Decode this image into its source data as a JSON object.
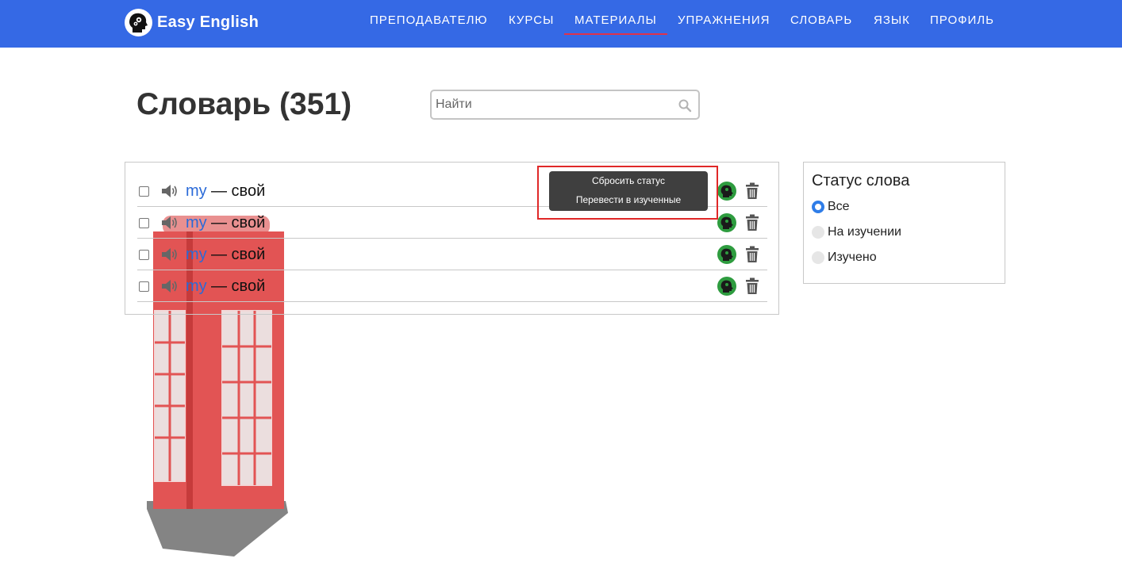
{
  "header": {
    "brand": "Easy English",
    "nav": [
      {
        "label": "ПРЕПОДАВАТЕЛЮ",
        "active": false
      },
      {
        "label": "КУРСЫ",
        "active": false
      },
      {
        "label": "МАТЕРИАЛЫ",
        "active": true
      },
      {
        "label": "УПРАЖНЕНИЯ",
        "active": false
      },
      {
        "label": "СЛОВАРЬ",
        "active": false
      },
      {
        "label": "ЯЗЫК",
        "active": false
      },
      {
        "label": "ПРОФИЛЬ",
        "active": false
      }
    ]
  },
  "page": {
    "title": "Словарь (351)",
    "search_placeholder": "Найти"
  },
  "words": [
    {
      "term": "my",
      "translation": "— свой"
    },
    {
      "term": "my",
      "translation": "— свой"
    },
    {
      "term": "my",
      "translation": "— свой"
    },
    {
      "term": "my",
      "translation": "— свой"
    }
  ],
  "tooltip": {
    "options": [
      "Сбросить статус",
      "Перевести в изученные"
    ]
  },
  "status_filter": {
    "title": "Статус слова",
    "options": [
      {
        "label": "Все",
        "checked": true
      },
      {
        "label": "На изучении",
        "checked": false
      },
      {
        "label": "Изучено",
        "checked": false
      }
    ]
  },
  "colors": {
    "header_bg": "#3569e5",
    "active_underline": "#e0324a",
    "term_link": "#2a6ad8",
    "status_icon": "#2e9c3f",
    "highlight": "#e02828"
  }
}
